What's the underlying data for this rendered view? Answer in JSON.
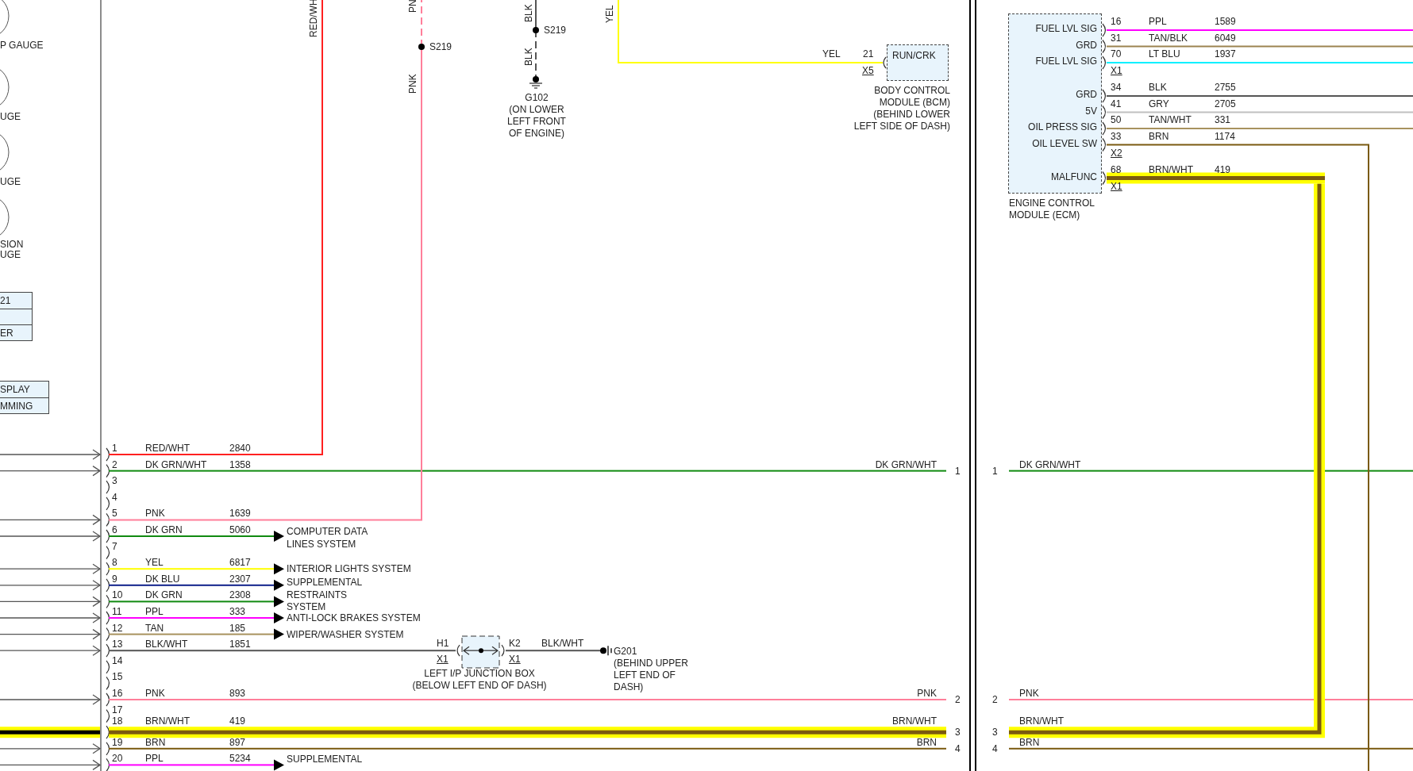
{
  "gauges": [
    {
      "lines": [
        "P GAUGE"
      ]
    },
    {
      "lines": [
        "UGE"
      ]
    },
    {
      "lines": [
        "UGE"
      ]
    },
    {
      "lines": [
        "SION",
        "UGE"
      ]
    }
  ],
  "indicator_tables": [
    {
      "rows": [
        {
          "text": "21"
        },
        {},
        {
          "text": "ER"
        }
      ]
    },
    {
      "rows": [
        {
          "text": "SPLAY"
        },
        {
          "text": "MMING"
        }
      ]
    }
  ],
  "risers": [
    {
      "label": "RED/WH"
    },
    {
      "label": "PNK",
      "top_label": "PN",
      "splice": "S219"
    }
  ],
  "ground_feed": {
    "wire_labels": [
      "BLK",
      "BLK"
    ],
    "splice": "S219",
    "ground_lines": [
      "G102",
      "(ON LOWER",
      "LEFT FRONT",
      "OF ENGINE)"
    ]
  },
  "bcm": {
    "feed_label": "YEL",
    "wire_label": "YEL",
    "pin": "21",
    "connector": "X5",
    "function": "RUN/CRK",
    "name_lines": [
      "BODY CONTROL",
      "MODULE (BCM)",
      "(BEHIND LOWER",
      "LEFT SIDE OF DASH)"
    ]
  },
  "connector_pins": [
    {
      "pin": "1",
      "wire": "RED/WHT",
      "circuit": "2840",
      "color": "#ff2020",
      "kind": "riser",
      "lead": true,
      "highlighted": false
    },
    {
      "pin": "2",
      "wire": "DK GRN/WHT",
      "circuit": "1358",
      "color": "#108a10",
      "kind": "inline",
      "lead": true,
      "highlighted": false
    },
    {
      "pin": "3"
    },
    {
      "pin": "4"
    },
    {
      "pin": "5",
      "wire": "PNK",
      "circuit": "1639",
      "color": "#ff7f9a",
      "kind": "riser",
      "lead": true,
      "highlighted": false
    },
    {
      "pin": "6",
      "wire": "DK GRN",
      "circuit": "5060",
      "color": "#108a10",
      "kind": "system",
      "lead": true,
      "highlighted": false
    },
    {
      "pin": "7"
    },
    {
      "pin": "8",
      "wire": "YEL",
      "circuit": "6817",
      "color": "#ffff00",
      "kind": "system",
      "lead": true,
      "highlighted": false
    },
    {
      "pin": "9",
      "wire": "DK BLU",
      "circuit": "2307",
      "color": "#10208a",
      "kind": "system",
      "lead": true,
      "highlighted": false
    },
    {
      "pin": "10",
      "wire": "DK GRN",
      "circuit": "2308",
      "color": "#108a10",
      "kind": "system",
      "lead": true,
      "highlighted": false
    },
    {
      "pin": "11",
      "wire": "PPL",
      "circuit": "333",
      "color": "#ff00ff",
      "kind": "system",
      "lead": true,
      "highlighted": false
    },
    {
      "pin": "12",
      "wire": "TAN",
      "circuit": "185",
      "color": "#a8925e",
      "kind": "system",
      "lead": true,
      "highlighted": false
    },
    {
      "pin": "13",
      "wire": "BLK/WHT",
      "circuit": "1851",
      "color": "#555555",
      "kind": "junction",
      "lead": true,
      "highlighted": false
    },
    {
      "pin": "14"
    },
    {
      "pin": "15"
    },
    {
      "pin": "16",
      "wire": "PNK",
      "circuit": "893",
      "color": "#ff7f9a",
      "kind": "inline",
      "lead": true,
      "highlighted": false
    },
    {
      "pin": "17"
    },
    {
      "pin": "18",
      "wire": "BRN/WHT",
      "circuit": "419",
      "color": "#7a5a10",
      "kind": "inline",
      "lead": true,
      "highlighted": true
    },
    {
      "pin": "19",
      "wire": "BRN",
      "circuit": "897",
      "color": "#7a5a10",
      "kind": "inline",
      "lead": true,
      "highlighted": false
    },
    {
      "pin": "20",
      "wire": "PPL",
      "circuit": "5234",
      "color": "#ff00ff",
      "kind": "system",
      "lead": true,
      "highlighted": false
    }
  ],
  "systems": [
    {
      "lines": [
        "COMPUTER DATA",
        "LINES SYSTEM"
      ]
    },
    {
      "lines": [
        "INTERIOR LIGHTS SYSTEM"
      ]
    },
    {
      "lines": [
        "SUPPLEMENTAL",
        "RESTRAINTS",
        "SYSTEM"
      ]
    },
    {
      "lines": [
        "ANTI-LOCK BRAKES SYSTEM"
      ]
    },
    {
      "lines": [
        "WIPER/WASHER SYSTEM"
      ]
    },
    {
      "lines": [
        "SUPPLEMENTAL"
      ]
    }
  ],
  "junction_box": {
    "left_pin": "H1",
    "left_connector": "X1",
    "right_pin": "K2",
    "right_connector": "X1",
    "name_lines": [
      "LEFT I/P JUNCTION BOX",
      "(BELOW LEFT END OF DASH)"
    ],
    "out_wire": "BLK/WHT",
    "ground_lines": [
      "G201",
      "(BEHIND UPPER",
      "LEFT END OF",
      "DASH)"
    ]
  },
  "inline_connector": {
    "left": [
      {
        "pin": "1",
        "wire": "DK GRN/WHT"
      },
      {
        "pin": "2",
        "wire": "PNK"
      },
      {
        "pin": "3",
        "wire": "BRN/WHT"
      },
      {
        "pin": "4",
        "wire": "BRN"
      }
    ],
    "right": [
      {
        "pin": "1",
        "wire": "DK GRN/WHT"
      },
      {
        "pin": "2",
        "wire": "PNK"
      },
      {
        "pin": "3",
        "wire": "BRN/WHT"
      },
      {
        "pin": "4",
        "wire": "BRN"
      }
    ]
  },
  "ecm": {
    "groups": [
      {
        "connector": "X1",
        "pins": [
          {
            "pin": "16",
            "function": "FUEL LVL SIG",
            "wire": "PPL",
            "circuit": "1589",
            "color": "#ff00ff",
            "highlighted": false
          },
          {
            "pin": "31",
            "function": "GRD",
            "wire": "TAN/BLK",
            "circuit": "6049",
            "color": "#9c8350",
            "highlighted": false
          },
          {
            "pin": "70",
            "function": "FUEL LVL SIG",
            "wire": "LT BLU",
            "circuit": "1937",
            "color": "#00f0ff",
            "highlighted": false
          }
        ]
      },
      {
        "connector": "X2",
        "pins": [
          {
            "pin": "34",
            "function": "GRD",
            "wire": "BLK",
            "circuit": "2755",
            "color": "#555555",
            "highlighted": false
          },
          {
            "pin": "41",
            "function": "5V",
            "wire": "GRY",
            "circuit": "2705",
            "color": "#c0c0c0",
            "highlighted": false
          },
          {
            "pin": "50",
            "function": "OIL PRESS SIG",
            "wire": "TAN/WHT",
            "circuit": "331",
            "color": "#a8925e",
            "highlighted": false
          },
          {
            "pin": "33",
            "function": "OIL LEVEL SW",
            "wire": "BRN",
            "circuit": "1174",
            "color": "#7a5a10",
            "kind": "drop",
            "highlighted": false
          }
        ]
      },
      {
        "connector": "X1",
        "pins": [
          {
            "pin": "68",
            "function": "MALFUNC",
            "wire": "BRN/WHT",
            "circuit": "419",
            "color": "#7a5a10",
            "kind": "trunk",
            "highlighted": true
          }
        ]
      }
    ],
    "name_lines": [
      "ENGINE CONTROL",
      "MODULE (ECM)"
    ]
  }
}
